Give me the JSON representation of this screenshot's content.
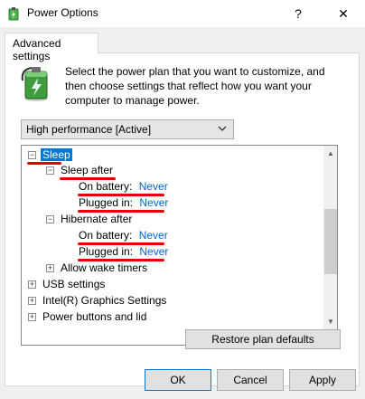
{
  "window": {
    "title": "Power Options",
    "help_glyph": "?",
    "close_glyph": "✕"
  },
  "tab": {
    "label": "Advanced settings"
  },
  "description": "Select the power plan that you want to customize, and then choose settings that reflect how you want your computer to manage power.",
  "plan_select": {
    "value": "High performance [Active]"
  },
  "tree": {
    "sleep": {
      "label": "Sleep",
      "expander": "−"
    },
    "sleep_after": {
      "label": "Sleep after",
      "expander": "−",
      "on_battery": {
        "label": "On battery:",
        "value": "Never"
      },
      "plugged_in": {
        "label": "Plugged in:",
        "value": "Never"
      }
    },
    "hibernate_after": {
      "label": "Hibernate after",
      "expander": "−",
      "on_battery": {
        "label": "On battery:",
        "value": "Never"
      },
      "plugged_in": {
        "label": "Plugged in:",
        "value": "Never"
      }
    },
    "allow_wake_timers": {
      "label": "Allow wake timers",
      "expander": "+"
    },
    "usb_settings": {
      "label": "USB settings",
      "expander": "+"
    },
    "intel_graphics": {
      "label": "Intel(R) Graphics Settings",
      "expander": "+"
    },
    "power_buttons": {
      "label": "Power buttons and lid",
      "expander": "+"
    }
  },
  "buttons": {
    "restore": "Restore plan defaults",
    "ok": "OK",
    "cancel": "Cancel",
    "apply": "Apply"
  },
  "colors": {
    "selection": "#0078d7",
    "link_value": "#0066cc",
    "annotation_underline": "#e00000"
  }
}
